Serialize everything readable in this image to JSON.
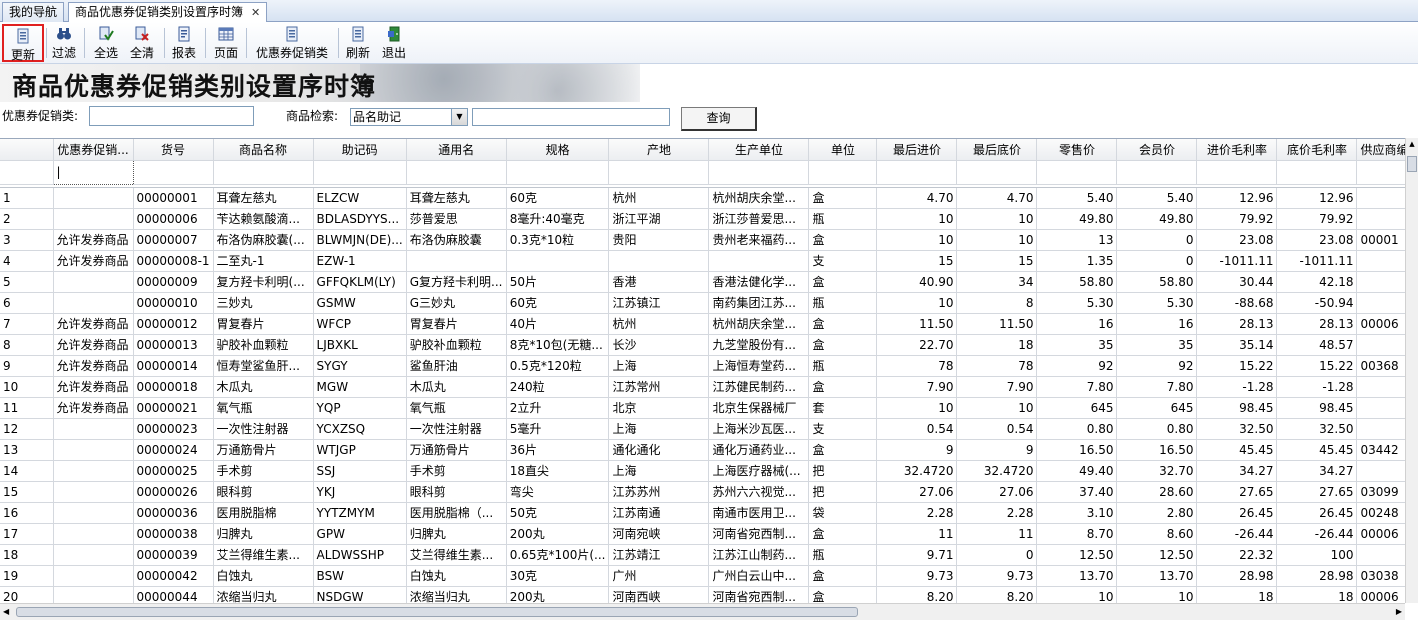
{
  "tabs": [
    {
      "label": "我的导航",
      "active": false
    },
    {
      "label": "商品优惠券促销类别设置序时簿",
      "active": true
    }
  ],
  "tab_close_glyph": "✕",
  "toolbar": {
    "buttons": [
      {
        "label": "更新",
        "icon": "update-icon"
      },
      {
        "label": "过滤",
        "icon": "filter-binoculars-icon"
      },
      {
        "label": "全选",
        "icon": "select-all-icon"
      },
      {
        "label": "全清",
        "icon": "clear-all-icon"
      },
      {
        "label": "报表",
        "icon": "report-icon"
      },
      {
        "label": "页面",
        "icon": "page-setup-icon"
      },
      {
        "label": "优惠券促销类",
        "icon": "coupon-category-icon"
      },
      {
        "label": "刷新",
        "icon": "refresh-icon"
      },
      {
        "label": "退出",
        "icon": "exit-door-icon"
      }
    ]
  },
  "banner": {
    "title": "商品优惠券促销类别设置序时簿"
  },
  "filters": {
    "coupon_label": "优惠券促销类:",
    "coupon_value": "",
    "search_label": "商品检索:",
    "search_mode": "品名助记",
    "search_value": "",
    "query_button": "查询"
  },
  "grid": {
    "columns": [
      "",
      "优惠券促销...",
      "货号",
      "商品名称",
      "助记码",
      "通用名",
      "规格",
      "产地",
      "生产单位",
      "单位",
      "最后进价",
      "最后底价",
      "零售价",
      "会员价",
      "进价毛利率",
      "底价毛利率",
      "供应商编"
    ],
    "rows": [
      [
        "1",
        "",
        "00000001",
        "耳聋左慈丸",
        "ELZCW",
        "耳聋左慈丸",
        "60克",
        "杭州",
        "杭州胡庆余堂...",
        "盒",
        "4.70",
        "4.70",
        "5.40",
        "5.40",
        "12.96",
        "12.96",
        ""
      ],
      [
        "2",
        "",
        "00000006",
        "苄达赖氨酸滴...",
        "BDLASDYYS...",
        "莎普爱思",
        "8毫升:40毫克",
        "浙江平湖",
        "浙江莎普爱思...",
        "瓶",
        "10",
        "10",
        "49.80",
        "49.80",
        "79.92",
        "79.92",
        ""
      ],
      [
        "3",
        "允许发券商品",
        "00000007",
        "布洛伪麻胶囊(...",
        "BLWMJN(DE)...",
        "布洛伪麻胶囊",
        "0.3克*10粒",
        "贵阳",
        "贵州老来福药...",
        "盒",
        "10",
        "10",
        "13",
        "0",
        "23.08",
        "23.08",
        "00001"
      ],
      [
        "4",
        "允许发券商品",
        "00000008-1",
        "二至丸-1",
        "EZW-1",
        "",
        "",
        "",
        "",
        "支",
        "15",
        "15",
        "1.35",
        "0",
        "-1011.11",
        "-1011.11",
        ""
      ],
      [
        "5",
        "",
        "00000009",
        "复方羟卡利明(...",
        "GFFQKLM(LY)",
        "G复方羟卡利明...",
        "50片",
        "香港",
        "香港法健化学...",
        "盒",
        "40.90",
        "34",
        "58.80",
        "58.80",
        "30.44",
        "42.18",
        ""
      ],
      [
        "6",
        "",
        "00000010",
        "三妙丸",
        "GSMW",
        "G三妙丸",
        "60克",
        "江苏镇江",
        "南药集团江苏...",
        "瓶",
        "10",
        "8",
        "5.30",
        "5.30",
        "-88.68",
        "-50.94",
        ""
      ],
      [
        "7",
        "允许发券商品",
        "00000012",
        "胃复春片",
        "WFCP",
        "胃复春片",
        "40片",
        "杭州",
        "杭州胡庆余堂...",
        "盒",
        "11.50",
        "11.50",
        "16",
        "16",
        "28.13",
        "28.13",
        "00006"
      ],
      [
        "8",
        "允许发券商品",
        "00000013",
        "驴胶补血颗粒",
        "LJBXKL",
        "驴胶补血颗粒",
        "8克*10包(无糖...",
        "长沙",
        "九芝堂股份有...",
        "盒",
        "22.70",
        "18",
        "35",
        "35",
        "35.14",
        "48.57",
        ""
      ],
      [
        "9",
        "允许发券商品",
        "00000014",
        "恒寿堂鲨鱼肝...",
        "SYGY",
        "鲨鱼肝油",
        "0.5克*120粒",
        "上海",
        "上海恒寿堂药...",
        "瓶",
        "78",
        "78",
        "92",
        "92",
        "15.22",
        "15.22",
        "00368"
      ],
      [
        "10",
        "允许发券商品",
        "00000018",
        "木瓜丸",
        "MGW",
        "木瓜丸",
        "240粒",
        "江苏常州",
        "江苏健民制药...",
        "盒",
        "7.90",
        "7.90",
        "7.80",
        "7.80",
        "-1.28",
        "-1.28",
        ""
      ],
      [
        "11",
        "允许发券商品",
        "00000021",
        "氧气瓶",
        "YQP",
        "氧气瓶",
        "2立升",
        "北京",
        "北京生保器械厂",
        "套",
        "10",
        "10",
        "645",
        "645",
        "98.45",
        "98.45",
        ""
      ],
      [
        "12",
        "",
        "00000023",
        "一次性注射器",
        "YCXZSQ",
        "一次性注射器",
        "5毫升",
        "上海",
        "上海米沙瓦医...",
        "支",
        "0.54",
        "0.54",
        "0.80",
        "0.80",
        "32.50",
        "32.50",
        ""
      ],
      [
        "13",
        "",
        "00000024",
        "万通筋骨片",
        "WTJGP",
        "万通筋骨片",
        "36片",
        "通化通化",
        "通化万通药业...",
        "盒",
        "9",
        "9",
        "16.50",
        "16.50",
        "45.45",
        "45.45",
        "03442"
      ],
      [
        "14",
        "",
        "00000025",
        "手术剪",
        "SSJ",
        "手术剪",
        "18直尖",
        "上海",
        "上海医疗器械(...",
        "把",
        "32.4720",
        "32.4720",
        "49.40",
        "32.70",
        "34.27",
        "34.27",
        ""
      ],
      [
        "15",
        "",
        "00000026",
        "眼科剪",
        "YKJ",
        "眼科剪",
        "弯尖",
        "江苏苏州",
        "苏州六六视觉...",
        "把",
        "27.06",
        "27.06",
        "37.40",
        "28.60",
        "27.65",
        "27.65",
        "03099"
      ],
      [
        "16",
        "",
        "00000036",
        "医用脱脂棉",
        "YYTZMYM",
        "医用脱脂棉（...",
        "50克",
        "江苏南通",
        "南通市医用卫...",
        "袋",
        "2.28",
        "2.28",
        "3.10",
        "2.80",
        "26.45",
        "26.45",
        "00248"
      ],
      [
        "17",
        "",
        "00000038",
        "归脾丸",
        "GPW",
        "归脾丸",
        "200丸",
        "河南宛峡",
        "河南省宛西制...",
        "盒",
        "11",
        "11",
        "8.70",
        "8.60",
        "-26.44",
        "-26.44",
        "00006"
      ],
      [
        "18",
        "",
        "00000039",
        "艾兰得维生素...",
        "ALDWSSHP",
        "艾兰得维生素...",
        "0.65克*100片(...",
        "江苏靖江",
        "江苏江山制药...",
        "瓶",
        "9.71",
        "0",
        "12.50",
        "12.50",
        "22.32",
        "100",
        ""
      ],
      [
        "19",
        "",
        "00000042",
        "白蚀丸",
        "BSW",
        "白蚀丸",
        "30克",
        "广州",
        "广州白云山中...",
        "盒",
        "9.73",
        "9.73",
        "13.70",
        "13.70",
        "28.98",
        "28.98",
        "03038"
      ],
      [
        "20",
        "",
        "00000044",
        "浓缩当归丸",
        "NSDGW",
        "浓缩当归丸",
        "200丸",
        "河南西峡",
        "河南省宛西制...",
        "盒",
        "8.20",
        "8.20",
        "10",
        "10",
        "18",
        "18",
        "00006"
      ]
    ]
  },
  "colors": {
    "accent_red": "#e02020",
    "header_bg": "#eceef1",
    "border": "#d4d8de"
  }
}
